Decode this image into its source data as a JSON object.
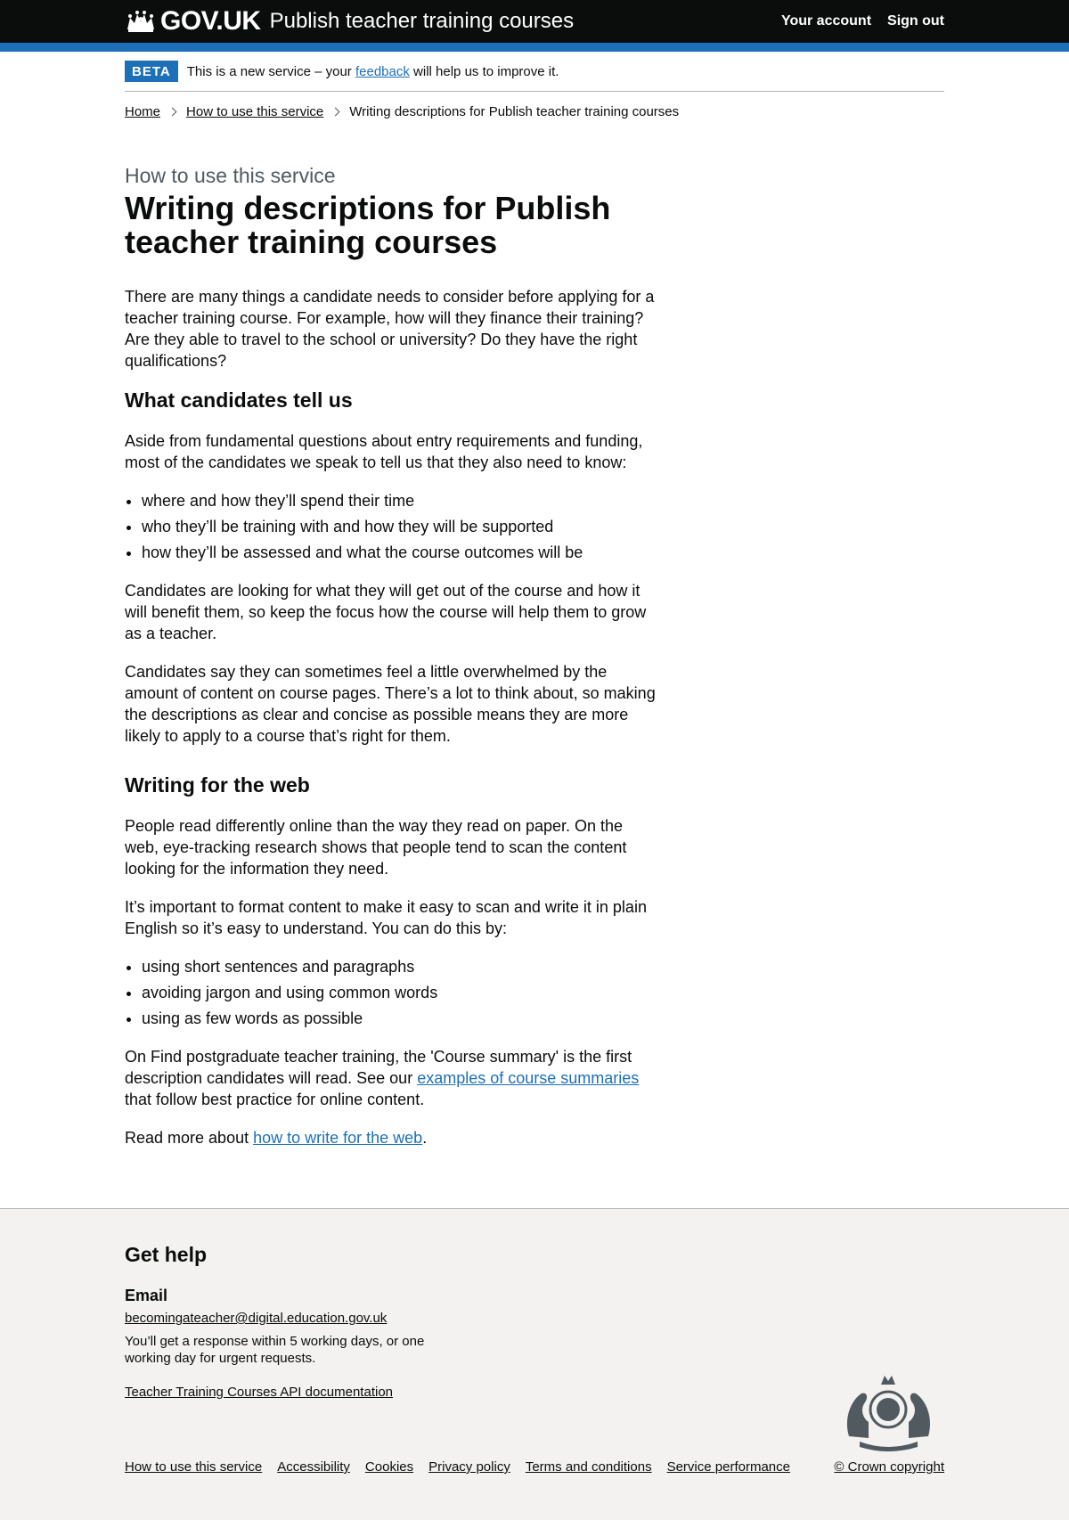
{
  "header": {
    "logotype": "GOV.UK",
    "service_name": "Publish teacher training courses",
    "nav": {
      "account": "Your account",
      "sign_out": "Sign out"
    }
  },
  "phase_banner": {
    "tag": "BETA",
    "text_before": "This is a new service – your ",
    "link": "feedback",
    "text_after": " will help us to improve it."
  },
  "breadcrumbs": {
    "home": "Home",
    "how_to": "How to use this service",
    "current": "Writing descriptions for Publish teacher training courses"
  },
  "main": {
    "caption": "How to use this service",
    "title": "Writing descriptions for Publish teacher training courses",
    "intro": "There are many things a candidate needs to consider before applying for a teacher training course. For example, how will they finance their training? Are they able to travel to the school or university? Do they have the right qualifications?",
    "section1": {
      "heading": "What candidates tell us",
      "p1": "Aside from fundamental questions about entry requirements and funding, most of the candidates we speak to tell us that they also need to know:",
      "list": [
        "where and how they’ll spend their time",
        "who they’ll be training with and how they will be supported",
        "how they’ll be assessed and what the course outcomes will be"
      ],
      "p2": "Candidates are looking for what they will get out of the course and how it will benefit them, so keep the focus how the course will help them to grow as a teacher.",
      "p3": "Candidates say they can sometimes feel a little overwhelmed by the amount of content on course pages. There’s a lot to think about, so making the descriptions as clear and concise as possible means they are more likely to apply to a course that’s right for them."
    },
    "section2": {
      "heading": "Writing for the web",
      "p1": "People read differently online than the way they read on paper. On the web, eye-tracking research shows that people tend to scan the content looking for the information they need.",
      "p2": "It’s important to format content to make it easy to scan and write it in plain English so it’s easy to understand. You can do this by:",
      "list": [
        "using short sentences and paragraphs",
        "avoiding jargon and using common words",
        "using as few words as possible"
      ],
      "p3_before": "On Find postgraduate teacher training, the 'Course summary' is the first description candidates will read. See our ",
      "p3_link": "examples of course summaries",
      "p3_after": " that follow best practice for online content.",
      "p4_before": "Read more about ",
      "p4_link": "how to write for the web",
      "p4_after": "."
    }
  },
  "footer": {
    "heading": "Get help",
    "email_label": "Email",
    "email": "becomingateacher@digital.education.gov.uk",
    "response": "You’ll get a response within 5 working days, or one working day for urgent requests.",
    "api_link": "Teacher Training Courses API documentation",
    "links": [
      "How to use this service",
      "Accessibility",
      "Cookies",
      "Privacy policy",
      "Terms and conditions",
      "Service performance"
    ],
    "copyright": "© Crown copyright"
  },
  "colors": {
    "header_bg": "#0b0c0c",
    "brand_blue": "#1d70b8",
    "footer_bg": "#f3f2f1",
    "secondary_text": "#505a5f"
  },
  "icons": {
    "logo": "crown-icon",
    "breadcrumb_separator": "chevron-right-icon",
    "footer_crest": "royal-coat-of-arms"
  }
}
